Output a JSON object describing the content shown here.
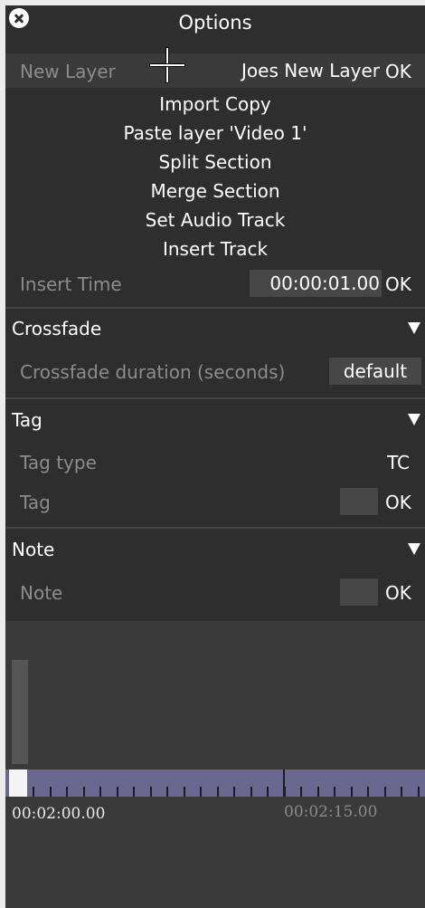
{
  "header": {
    "title": "Options"
  },
  "new_layer": {
    "label": "New Layer",
    "value": "Joes New Layer",
    "ok": "OK"
  },
  "menu": [
    "Import Copy",
    "Paste layer 'Video 1'",
    "Split Section",
    "Merge Section",
    "Set Audio Track",
    "Insert Track"
  ],
  "insert_time": {
    "label": "Insert Time",
    "value": "00:00:01.00",
    "ok": "OK"
  },
  "crossfade": {
    "title": "Crossfade",
    "duration_label": "Crossfade duration (seconds)",
    "duration_value": "default"
  },
  "tag": {
    "title": "Tag",
    "type_label": "Tag type",
    "type_value": "TC",
    "tag_label": "Tag",
    "tag_value": "",
    "ok": "OK"
  },
  "note": {
    "title": "Note",
    "note_label": "Note",
    "note_value": "",
    "ok": "OK"
  },
  "timeline": {
    "time_start": "00:02:00.00",
    "time_mid": "00:02:15.00"
  },
  "colors": {
    "panel_bg": "#2e2e2e",
    "ruler": "#6b6890",
    "muted_text": "#8c8c8c"
  }
}
